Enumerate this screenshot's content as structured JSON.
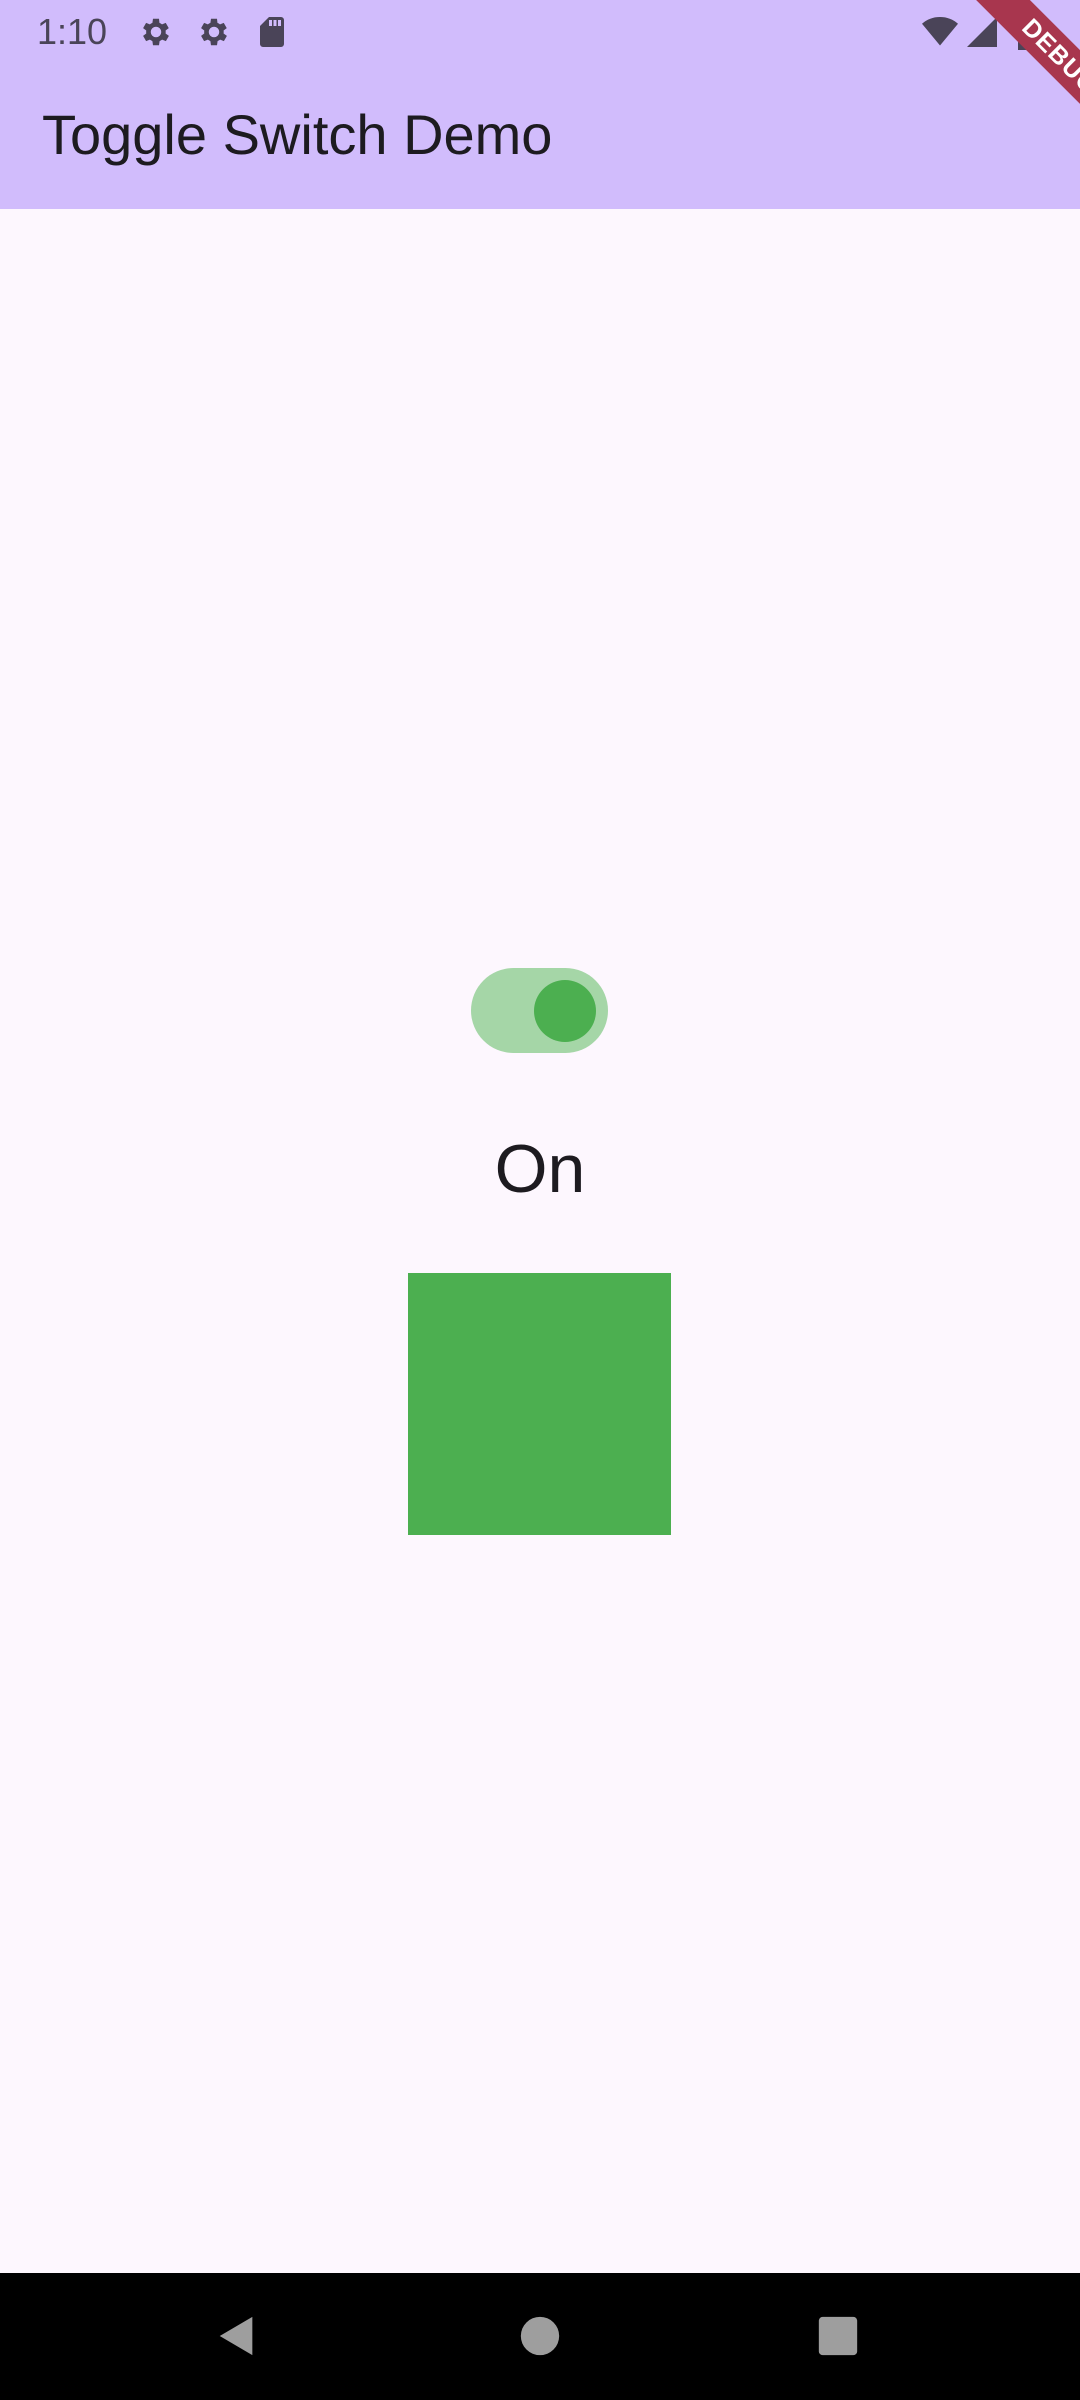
{
  "status_bar": {
    "time": "1:10",
    "icons": [
      "settings-icon",
      "settings-icon",
      "sd-card-icon",
      "wifi-icon",
      "signal-icon",
      "battery-icon"
    ]
  },
  "app_bar": {
    "title": "Toggle Switch Demo",
    "background": "#D1BCFC"
  },
  "debug_banner": {
    "label": "DEBUG",
    "color": "#A8364E"
  },
  "toggle": {
    "state": "on",
    "track_color": "#A5D6A7",
    "thumb_color": "#4CAF50"
  },
  "state_label": "On",
  "state_box": {
    "color": "#4CAF50"
  },
  "nav_bar": {
    "buttons": [
      "back-icon",
      "home-icon",
      "recents-icon"
    ]
  }
}
